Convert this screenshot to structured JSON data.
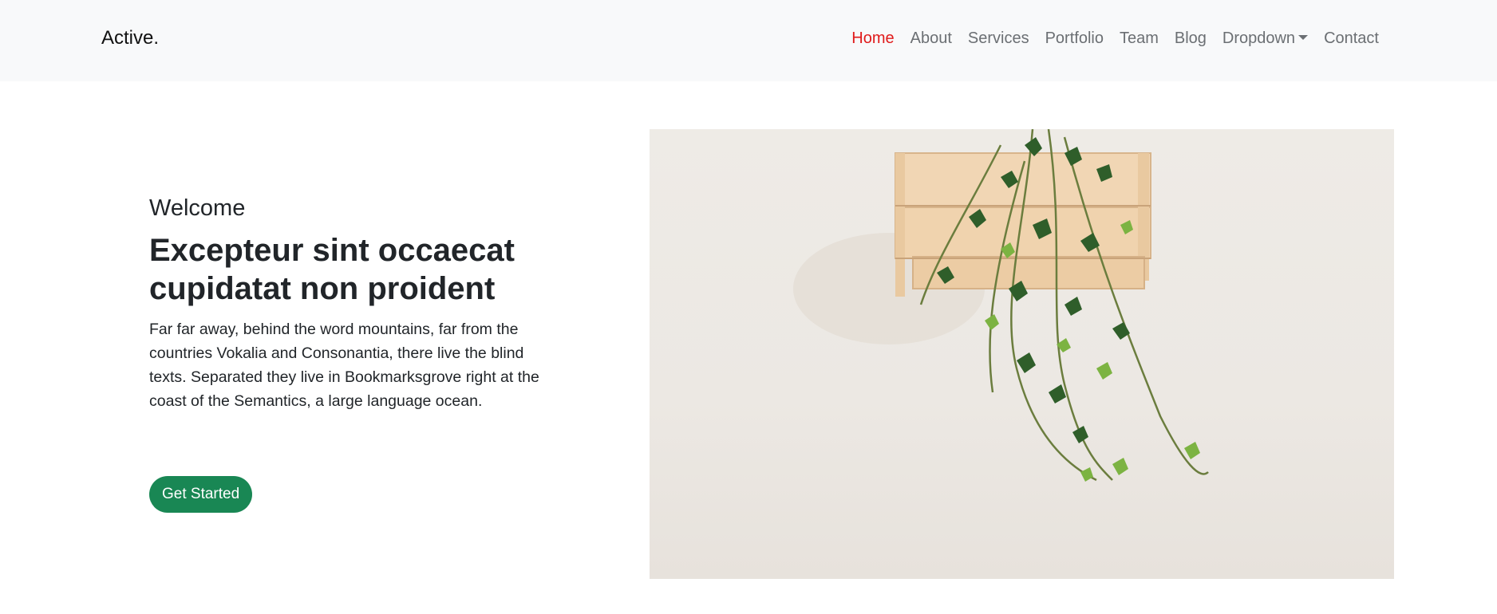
{
  "navbar": {
    "brand": "Active.",
    "links": [
      {
        "label": "Home",
        "active": true
      },
      {
        "label": "About"
      },
      {
        "label": "Services"
      },
      {
        "label": "Portfolio"
      },
      {
        "label": "Team"
      },
      {
        "label": "Blog"
      },
      {
        "label": "Dropdown",
        "has_caret": true
      },
      {
        "label": "Contact"
      }
    ]
  },
  "hero": {
    "welcome": "Welcome",
    "headline_line1": "Excepteur sint occaecat",
    "headline_line2": "cupidatat non proident",
    "paragraph": "Far far away, behind the word mountains, far from the countries Vokalia and Consonantia, there live the blind texts. Separated they live in Bookmarksgrove right at the coast of the Semantics, a large language ocean.",
    "cta_label": "Get Started",
    "image_subject": "ivy-plant-in-wooden-crate"
  },
  "colors": {
    "navbar_bg": "#f8f9fa",
    "nav_active": "#e01b1b",
    "nav_default": "#6b6f73",
    "cta_bg": "#198754",
    "image_bg": "#ece8e3"
  }
}
